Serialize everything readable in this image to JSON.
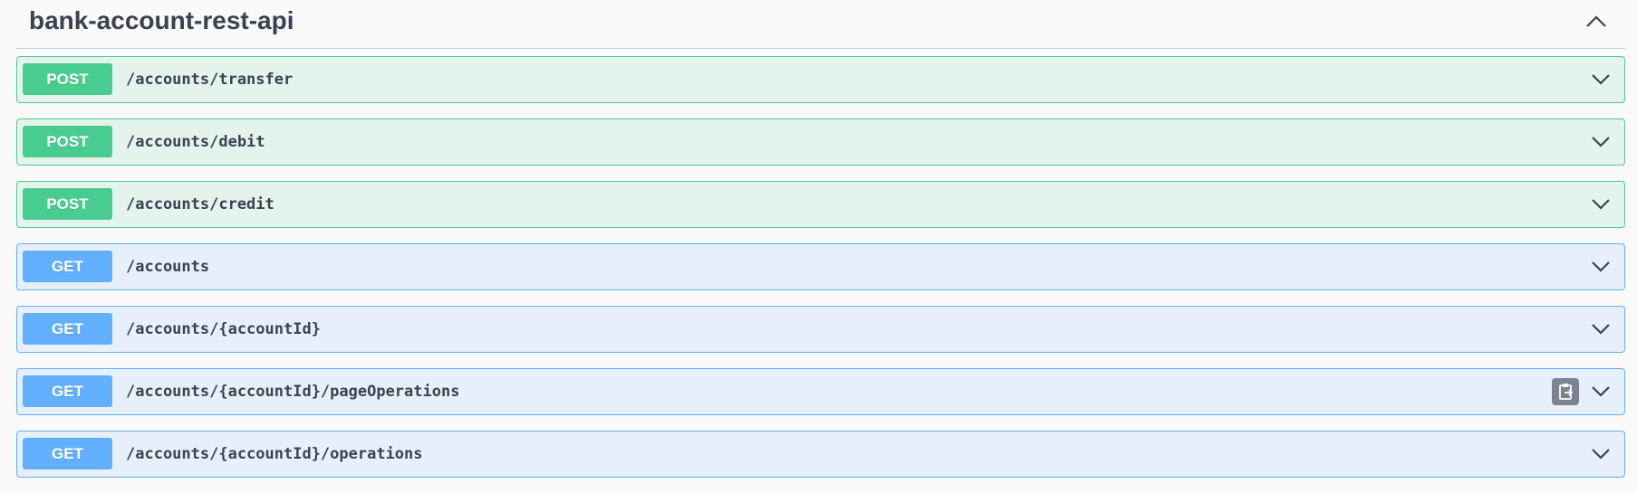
{
  "section": {
    "title": "bank-account-rest-api"
  },
  "operations": [
    {
      "method": "POST",
      "path": "/accounts/transfer"
    },
    {
      "method": "POST",
      "path": "/accounts/debit"
    },
    {
      "method": "POST",
      "path": "/accounts/credit"
    },
    {
      "method": "GET",
      "path": "/accounts"
    },
    {
      "method": "GET",
      "path": "/accounts/{accountId}"
    },
    {
      "method": "GET",
      "path": "/accounts/{accountId}/pageOperations",
      "has_copy_icon": true
    },
    {
      "method": "GET",
      "path": "/accounts/{accountId}/operations"
    }
  ],
  "colors": {
    "post": "#49cc90",
    "get": "#61affe",
    "text": "#3b4151"
  },
  "icons": {
    "section_toggle": "chevron-up-icon",
    "row_toggle": "chevron-down-icon",
    "copy": "copy-to-clipboard-icon"
  }
}
